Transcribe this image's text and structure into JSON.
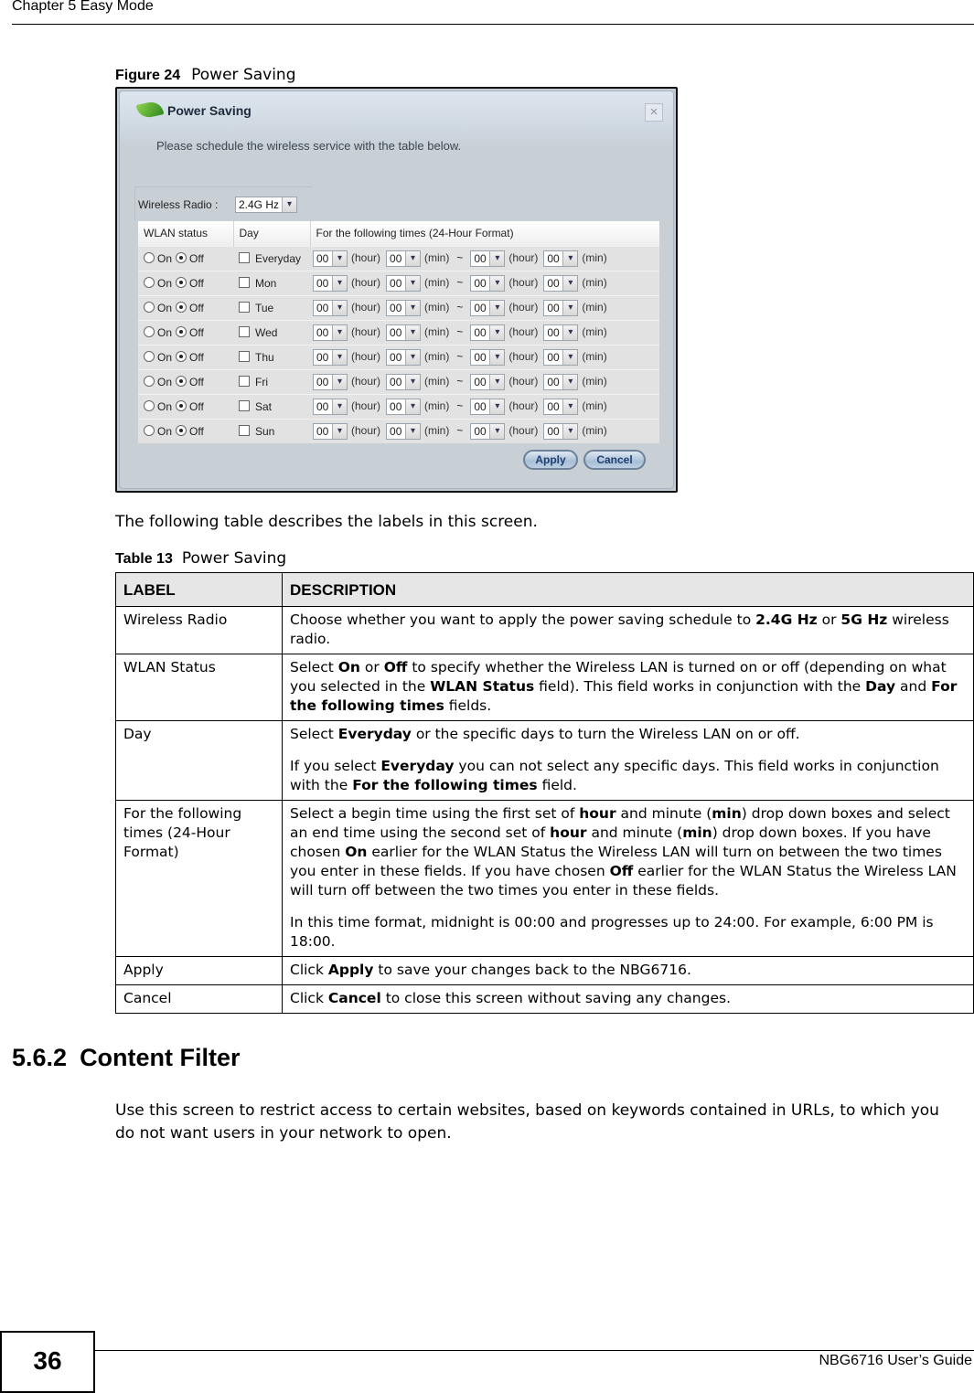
{
  "page_header": {
    "chapter": "Chapter 5 Easy Mode"
  },
  "figure": {
    "number": "Figure 24",
    "title": "Power Saving"
  },
  "dialog": {
    "title": "Power Saving",
    "close_icon": "close-icon",
    "instruction": "Please schedule the wireless service with the table below.",
    "wireless_radio": {
      "label": "Wireless Radio :",
      "value": "2.4G Hz"
    },
    "table": {
      "headers": [
        "WLAN status",
        "Day",
        "For the following times (24-Hour Format)"
      ],
      "on_label": "On",
      "off_label": "Off",
      "hour_unit": "(hour)",
      "min_unit": "(min)",
      "separator": "~",
      "rows": [
        {
          "day": "Everyday",
          "status": "Off",
          "day_checked": false,
          "start_hour": "00",
          "start_min": "00",
          "end_hour": "00",
          "end_min": "00"
        },
        {
          "day": "Mon",
          "status": "Off",
          "day_checked": false,
          "start_hour": "00",
          "start_min": "00",
          "end_hour": "00",
          "end_min": "00"
        },
        {
          "day": "Tue",
          "status": "Off",
          "day_checked": false,
          "start_hour": "00",
          "start_min": "00",
          "end_hour": "00",
          "end_min": "00"
        },
        {
          "day": "Wed",
          "status": "Off",
          "day_checked": false,
          "start_hour": "00",
          "start_min": "00",
          "end_hour": "00",
          "end_min": "00"
        },
        {
          "day": "Thu",
          "status": "Off",
          "day_checked": false,
          "start_hour": "00",
          "start_min": "00",
          "end_hour": "00",
          "end_min": "00"
        },
        {
          "day": "Fri",
          "status": "Off",
          "day_checked": false,
          "start_hour": "00",
          "start_min": "00",
          "end_hour": "00",
          "end_min": "00"
        },
        {
          "day": "Sat",
          "status": "Off",
          "day_checked": false,
          "start_hour": "00",
          "start_min": "00",
          "end_hour": "00",
          "end_min": "00"
        },
        {
          "day": "Sun",
          "status": "Off",
          "day_checked": false,
          "start_hour": "00",
          "start_min": "00",
          "end_hour": "00",
          "end_min": "00"
        }
      ]
    },
    "buttons": {
      "apply": "Apply",
      "cancel": "Cancel"
    }
  },
  "intro_text": "The following table describes the labels in this screen.",
  "table13": {
    "number": "Table 13",
    "title": "Power Saving",
    "headers": [
      "LABEL",
      "DESCRIPTION"
    ],
    "rows": [
      {
        "label": "Wireless Radio",
        "paragraphs": [
          [
            [
              "Choose whether you want to apply the power saving schedule to ",
              false
            ],
            [
              "2.4G Hz",
              true
            ],
            [
              " or ",
              false
            ],
            [
              "5G Hz",
              true
            ],
            [
              " wireless radio.",
              false
            ]
          ]
        ]
      },
      {
        "label": "WLAN Status",
        "paragraphs": [
          [
            [
              "Select ",
              false
            ],
            [
              "On",
              true
            ],
            [
              " or ",
              false
            ],
            [
              "Off",
              true
            ],
            [
              " to specify whether the Wireless LAN is turned on or off (depending on what you selected in the ",
              false
            ],
            [
              "WLAN Status",
              true
            ],
            [
              " field). This field works in conjunction with the ",
              false
            ],
            [
              "Day",
              true
            ],
            [
              " and ",
              false
            ],
            [
              "For the following times",
              true
            ],
            [
              " fields.",
              false
            ]
          ]
        ]
      },
      {
        "label": "Day",
        "paragraphs": [
          [
            [
              "Select ",
              false
            ],
            [
              "Everyday",
              true
            ],
            [
              " or the specific days to turn the Wireless LAN on or off.",
              false
            ]
          ],
          [
            [
              "If you select ",
              false
            ],
            [
              "Everyday",
              true
            ],
            [
              " you can not select any specific days. This field works in conjunction with the ",
              false
            ],
            [
              "For the following times",
              true
            ],
            [
              " field.",
              false
            ]
          ]
        ]
      },
      {
        "label": "For the following times (24-Hour Format)",
        "paragraphs": [
          [
            [
              "Select a begin time using the first set of ",
              false
            ],
            [
              "hour",
              true
            ],
            [
              " and minute (",
              false
            ],
            [
              "min",
              true
            ],
            [
              ") drop down boxes and select an end time using the second set of ",
              false
            ],
            [
              "hour",
              true
            ],
            [
              " and minute (",
              false
            ],
            [
              "min",
              true
            ],
            [
              ") drop down boxes. If you have chosen ",
              false
            ],
            [
              "On",
              true
            ],
            [
              " earlier for the WLAN Status the Wireless LAN will turn on between the two times you enter in these fields. If you have chosen ",
              false
            ],
            [
              "Off",
              true
            ],
            [
              " earlier for the WLAN Status the Wireless LAN will turn off between the two times you enter in these fields.",
              false
            ]
          ],
          [
            [
              "In this time format, midnight is 00:00 and progresses up to 24:00. For example, 6:00 PM is 18:00.",
              false
            ]
          ]
        ]
      },
      {
        "label": "Apply",
        "paragraphs": [
          [
            [
              "Click ",
              false
            ],
            [
              "Apply",
              true
            ],
            [
              " to save your changes back to the NBG6716.",
              false
            ]
          ]
        ]
      },
      {
        "label": "Cancel",
        "paragraphs": [
          [
            [
              "Click ",
              false
            ],
            [
              "Cancel",
              true
            ],
            [
              " to close this screen without saving any changes.",
              false
            ]
          ]
        ]
      }
    ]
  },
  "section": {
    "number": "5.6.2",
    "title": "Content Filter",
    "body": "Use this screen to restrict access to certain websites, based on keywords contained in URLs, to which you do not want users in your network to open."
  },
  "footer": {
    "page_number": "36",
    "guide": "NBG6716 User’s Guide"
  }
}
